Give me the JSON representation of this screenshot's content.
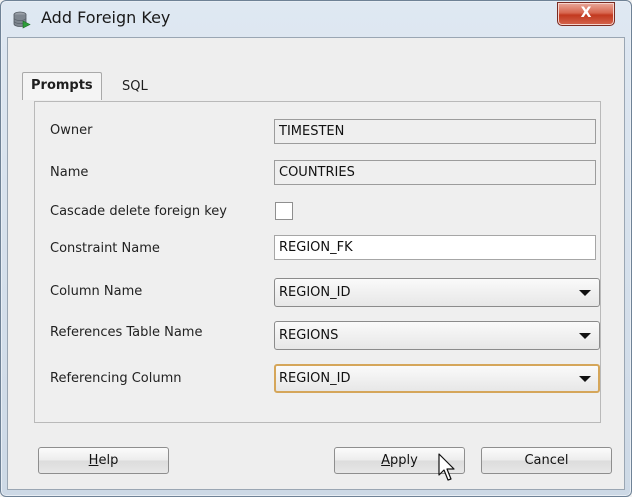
{
  "window": {
    "title": "Add Foreign Key",
    "close_label": "X"
  },
  "tabs": [
    {
      "label": "Prompts",
      "active": true
    },
    {
      "label": "SQL",
      "active": false
    }
  ],
  "form": {
    "owner": {
      "label": "Owner",
      "value": "TIMESTEN"
    },
    "name": {
      "label": "Name",
      "value": "COUNTRIES"
    },
    "cascade": {
      "label": "Cascade delete foreign key",
      "checked": false
    },
    "constraint_name": {
      "label": "Constraint Name",
      "value": "REGION_FK"
    },
    "column_name": {
      "label": "Column Name",
      "value": "REGION_ID"
    },
    "references_table": {
      "label": "References Table Name",
      "value": "REGIONS"
    },
    "referencing_column": {
      "label": "Referencing Column",
      "value": "REGION_ID"
    }
  },
  "buttons": {
    "help": {
      "mnemonic": "H",
      "rest": "elp"
    },
    "apply": {
      "mnemonic": "A",
      "rest": "pply"
    },
    "cancel": {
      "label": "Cancel"
    }
  },
  "colors": {
    "close_button": "#c2391f",
    "focus_ring": "#d5a65a",
    "title_bar": "#dfe8f2"
  }
}
